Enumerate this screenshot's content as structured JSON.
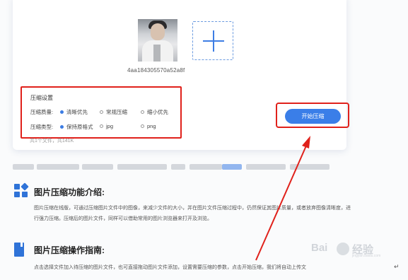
{
  "upload": {
    "filename": "4aa184305570a52a8f",
    "file_count": "共1个文件，共141K",
    "add_icon": "plus-icon"
  },
  "settings": {
    "title": "压缩设置",
    "quality_label": "压缩质量:",
    "quality_options": [
      "清晰优先",
      "常规压缩",
      "缩小优先"
    ],
    "quality_selected": "清晰优先",
    "type_label": "压缩类型:",
    "type_options": [
      "保持原格式",
      "jpg",
      "png"
    ],
    "type_selected": "保持原格式"
  },
  "actions": {
    "start_label": "开始压缩"
  },
  "sections": [
    {
      "title": "图片压缩功能介绍:",
      "icon": "grid-icon",
      "text": "图片压缩在线版，可通过压缩图片文件中的图像，来减少文件的大小，并在图片文件压缩过程中，仍然保证其图片质量，或者放弃图像清晰度，进行强力压缩。压缩后的图片文件，同样可以借助常用的图片浏览器来打开及浏览。"
    },
    {
      "title": "图片压缩操作指南:",
      "icon": "book-icon",
      "text": "点击选择文件加入待压缩的图片文件，也可直接拖动图片文件添加，设置需要压缩的参数，点击开始压缩，我们将自动上传文"
    }
  ],
  "watermark": {
    "text_left": "Bai",
    "text_right": "经验",
    "sub": "jingyan.baidu.com"
  },
  "colors": {
    "accent": "#3a7ee8",
    "highlight": "#e0211b",
    "icon_blue": "#2f73d8"
  },
  "return_mark": "↵"
}
